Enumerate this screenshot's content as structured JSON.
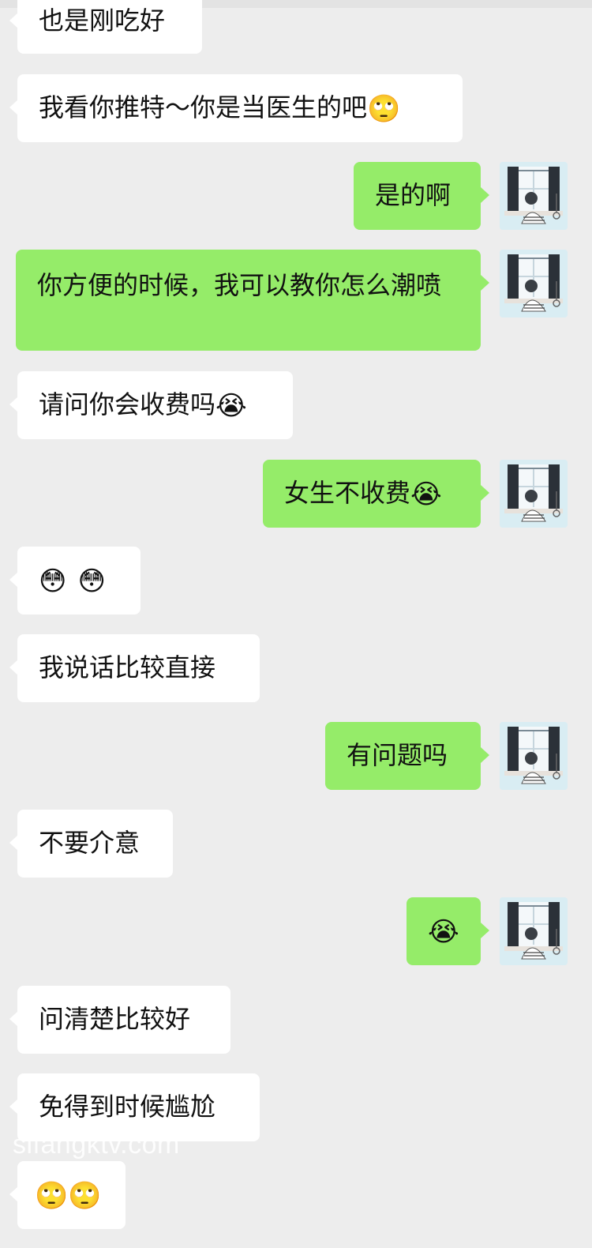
{
  "messages": [
    {
      "side": "in",
      "text": "也是刚吃好",
      "emoji": ""
    },
    {
      "side": "in",
      "text": "我看你推特～你是当医生的吧",
      "emoji": "🙄"
    },
    {
      "side": "out",
      "text": "是的啊",
      "emoji": ""
    },
    {
      "side": "out",
      "text": "你方便的时候，我可以教你怎么潮喷",
      "emoji": ""
    },
    {
      "side": "in",
      "text": "请问你会收费吗",
      "emoji": "😭"
    },
    {
      "side": "out",
      "text": "女生不收费",
      "emoji": "😭"
    },
    {
      "side": "in",
      "text": "",
      "emoji": "😳",
      "emoji2": "😳"
    },
    {
      "side": "in",
      "text": "我说话比较直接",
      "emoji": ""
    },
    {
      "side": "out",
      "text": "有问题吗",
      "emoji": ""
    },
    {
      "side": "in",
      "text": "不要介意",
      "emoji": ""
    },
    {
      "side": "out",
      "text": "",
      "emoji": "😭"
    },
    {
      "side": "in",
      "text": "问清楚比较好",
      "emoji": ""
    },
    {
      "side": "in",
      "text": "免得到时候尴尬",
      "emoji": ""
    },
    {
      "side": "in",
      "text": "",
      "emoji": "🙄",
      "emoji2": "🙄"
    }
  ],
  "watermark": "sifangktv.com",
  "colors": {
    "background": "#ededed",
    "incoming": "#ffffff",
    "outgoing": "#95ec69"
  },
  "avatar_icon": "window-illustration-avatar"
}
